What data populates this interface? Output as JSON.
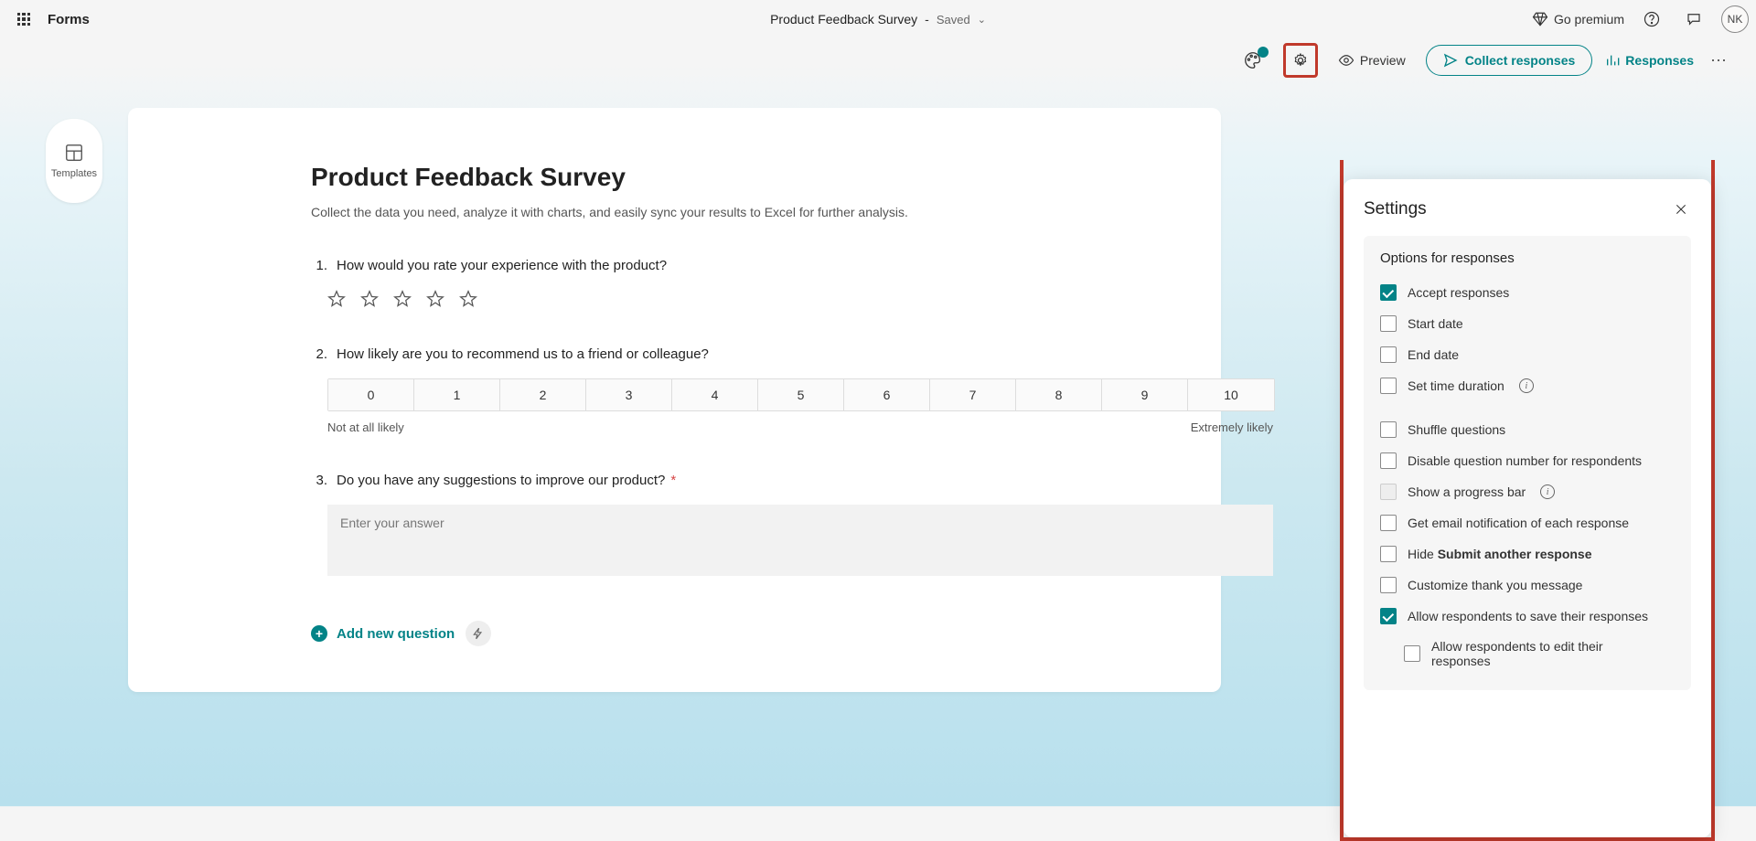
{
  "header": {
    "app_title": "Forms",
    "form_name": "Product Feedback Survey",
    "status": "Saved",
    "go_premium": "Go premium",
    "avatar_initials": "NK"
  },
  "toolbar": {
    "preview": "Preview",
    "collect": "Collect responses",
    "responses": "Responses"
  },
  "templates_tab": "Templates",
  "form": {
    "title": "Product Feedback Survey",
    "description": "Collect the data you need, analyze it with charts, and easily sync your results to Excel for further analysis.",
    "questions": [
      {
        "num": "1.",
        "text": "How would you rate your experience with the product?"
      },
      {
        "num": "2.",
        "text": "How likely are you to recommend us to a friend or colleague?"
      },
      {
        "num": "3.",
        "text": "Do you have any suggestions to improve our product?"
      }
    ],
    "nps_values": [
      "0",
      "1",
      "2",
      "3",
      "4",
      "5",
      "6",
      "7",
      "8",
      "9",
      "10"
    ],
    "nps_low_label": "Not at all likely",
    "nps_high_label": "Extremely likely",
    "answer_placeholder": "Enter your answer",
    "add_question": "Add new question"
  },
  "settings": {
    "panel_title": "Settings",
    "section_title": "Options for responses",
    "options": {
      "accept": {
        "label": "Accept responses",
        "checked": true
      },
      "start_date": {
        "label": "Start date",
        "checked": false
      },
      "end_date": {
        "label": "End date",
        "checked": false
      },
      "time_duration": {
        "label": "Set time duration",
        "checked": false,
        "info": true
      },
      "shuffle": {
        "label": "Shuffle questions",
        "checked": false
      },
      "disable_number": {
        "label": "Disable question number for respondents",
        "checked": false
      },
      "progress_bar": {
        "label": "Show a progress bar",
        "checked": false,
        "disabled": true,
        "info": true
      },
      "email_notif": {
        "label": "Get email notification of each response",
        "checked": false
      },
      "hide_submit_prefix": "Hide ",
      "hide_submit_bold": "Submit another response",
      "customize_thanks": {
        "label": "Customize thank you message",
        "checked": false
      },
      "allow_save": {
        "label": "Allow respondents to save their responses",
        "checked": true
      },
      "allow_edit": {
        "label": "Allow respondents to edit their responses",
        "checked": false
      }
    }
  }
}
